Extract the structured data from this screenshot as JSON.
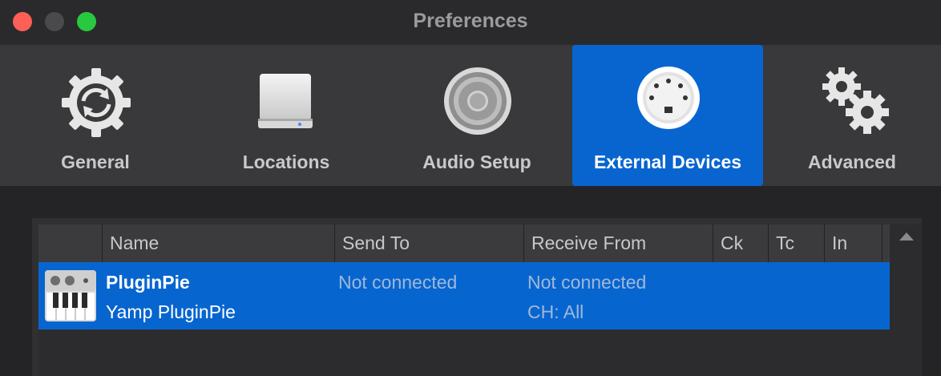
{
  "window": {
    "title": "Preferences"
  },
  "tabs": [
    {
      "label": "General"
    },
    {
      "label": "Locations"
    },
    {
      "label": "Audio Setup"
    },
    {
      "label": "External Devices"
    },
    {
      "label": "Advanced"
    }
  ],
  "table": {
    "columns": [
      "Name",
      "Send To",
      "Receive From",
      "Ck",
      "Tc",
      "In"
    ],
    "rows": [
      {
        "name": "PluginPie",
        "subname": "Yamp PluginPie",
        "send_to": "Not connected",
        "receive_from": "Not connected",
        "receive_channel": "CH: All",
        "icon": "keyboard-icon"
      }
    ]
  },
  "colors": {
    "selection": "#0765cf",
    "accent": "#0865d0"
  }
}
